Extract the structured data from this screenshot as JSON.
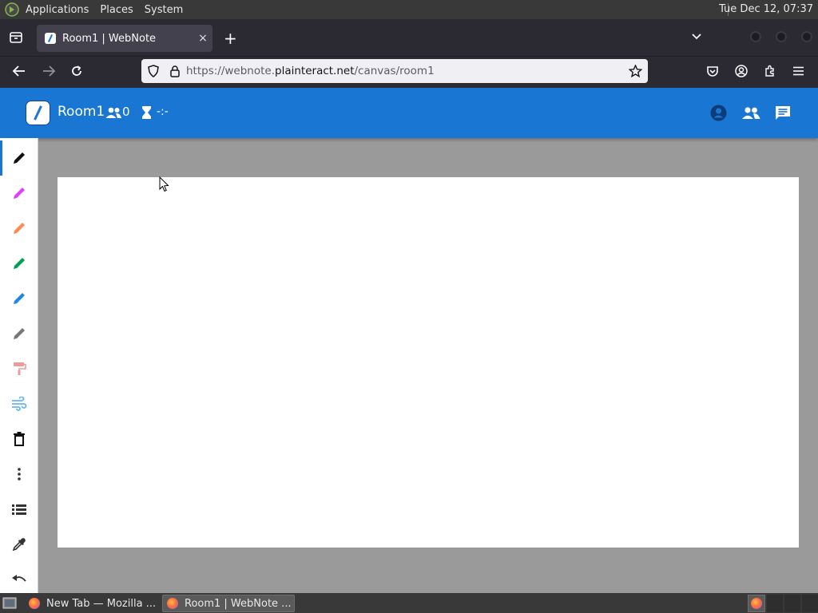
{
  "desktop": {
    "menus": [
      "Applications",
      "Places",
      "System"
    ],
    "clock": "Tue Dec 12, 07:37"
  },
  "browser": {
    "tab_title": "Room1 | WebNote",
    "tab_close": "×",
    "new_tab": "+",
    "url_prefix": "https://webnote.",
    "url_domain": "plainteract.net",
    "url_path": "/canvas/room1"
  },
  "app": {
    "room_name": "Room1",
    "user_count": "0",
    "timer": "-:-",
    "header_color": "#1976d2"
  },
  "toolbar": {
    "tools": [
      {
        "name": "pen-black",
        "color": "#111111"
      },
      {
        "name": "pen-pink",
        "color": "#e040fb"
      },
      {
        "name": "pen-orange",
        "color": "#ff8a50"
      },
      {
        "name": "pen-green",
        "color": "#00a152"
      },
      {
        "name": "pen-blue",
        "color": "#1e88e5"
      },
      {
        "name": "pen-gray",
        "color": "#777777"
      },
      {
        "name": "paint-roller",
        "color": "#ef9a9a"
      },
      {
        "name": "air-brush",
        "color": "#64b5f6"
      },
      {
        "name": "trash",
        "color": "#111111"
      },
      {
        "name": "more-vertical",
        "color": "#333333"
      },
      {
        "name": "list",
        "color": "#333333"
      },
      {
        "name": "eyedropper",
        "color": "#333333"
      },
      {
        "name": "undo",
        "color": "#333333"
      }
    ]
  },
  "taskbar": {
    "tasks": [
      "New Tab — Mozilla ...",
      "Room1 | WebNote ..."
    ]
  }
}
